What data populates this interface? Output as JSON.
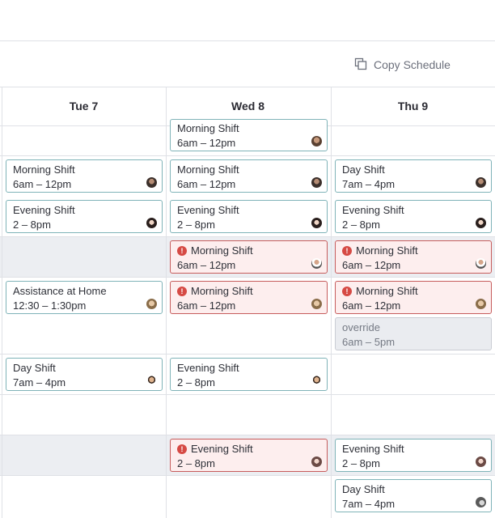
{
  "toolbar": {
    "copy_label": "Copy Schedule",
    "copy_icon": "copy-icon"
  },
  "days": [
    {
      "label": "Tue 7"
    },
    {
      "label": "Wed 8"
    },
    {
      "label": "Thu 9"
    }
  ],
  "colors": {
    "card_border": "#7fb3b8",
    "error_border": "#c65c5c",
    "error_bg": "#fdeeee",
    "error_icon": "#d64a44",
    "override_bg": "#eaecf0",
    "band_bg": "#eceef2"
  },
  "cards": {
    "wed_top": {
      "title": "Morning Shift",
      "time": "6am – 12pm"
    },
    "tue_r1": {
      "title": "Morning Shift",
      "time": "6am – 12pm"
    },
    "wed_r1": {
      "title": "Morning Shift",
      "time": "6am – 12pm"
    },
    "thu_r1": {
      "title": "Day Shift",
      "time": "7am – 4pm"
    },
    "tue_r2": {
      "title": "Evening Shift",
      "time": "2 – 8pm"
    },
    "wed_r2": {
      "title": "Evening Shift",
      "time": "2 – 8pm"
    },
    "thu_r2": {
      "title": "Evening Shift",
      "time": "2 – 8pm"
    },
    "wed_r3": {
      "title": "Morning Shift",
      "time": "6am – 12pm",
      "status": "error"
    },
    "thu_r3": {
      "title": "Morning Shift",
      "time": "6am – 12pm",
      "status": "error"
    },
    "tue_r4": {
      "title": "Assistance at Home",
      "time": "12:30 – 1:30pm"
    },
    "wed_r4": {
      "title": "Morning Shift",
      "time": "6am – 12pm",
      "status": "error"
    },
    "thu_r4": {
      "title": "Morning Shift",
      "time": "6am – 12pm",
      "status": "error"
    },
    "thu_override": {
      "title": "override",
      "time": "6am – 5pm"
    },
    "tue_r5": {
      "title": "Day Shift",
      "time": "7am – 4pm"
    },
    "wed_r5": {
      "title": "Evening Shift",
      "time": "2 – 8pm"
    },
    "wed_r7": {
      "title": "Evening Shift",
      "time": "2 – 8pm",
      "status": "error"
    },
    "thu_r7": {
      "title": "Evening Shift",
      "time": "2 – 8pm"
    },
    "thu_r8": {
      "title": "Day Shift",
      "time": "7am – 4pm"
    }
  },
  "error_glyph": "!"
}
